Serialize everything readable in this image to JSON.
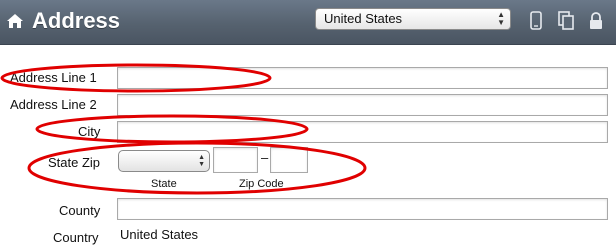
{
  "header": {
    "title": "Address",
    "country_selected": "United States",
    "colors": {
      "bar_top": "#6a7889",
      "bar_bottom": "#4a5562",
      "title": "#ffffff"
    }
  },
  "form": {
    "address_line_1_label": "Address Line 1",
    "address_line_1_value": "",
    "address_line_2_label": "Address Line 2",
    "address_line_2_value": "",
    "city_label": "City",
    "city_value": "",
    "state_zip_label": "State Zip",
    "state_value": "",
    "state_caption": "State",
    "zip_caption": "Zip Code",
    "zip_separator": "–",
    "zip_part1": "",
    "zip_part2": "",
    "county_label": "County",
    "county_value": "",
    "country_label": "Country",
    "country_value": "United States"
  },
  "icons": {
    "home": "home-icon",
    "mobile": "mobile-device-icon",
    "copy": "copy-icon",
    "lock": "lock-icon"
  },
  "annotation_color": "#e00000"
}
